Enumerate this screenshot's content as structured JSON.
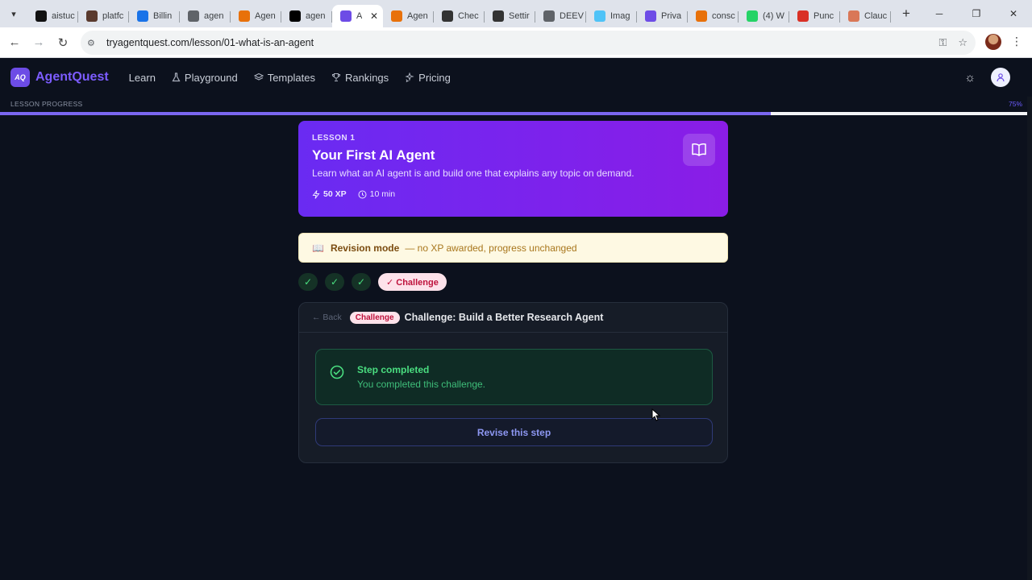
{
  "browser": {
    "tabs": [
      {
        "title": "aistuc",
        "favicon_color": "#111111",
        "active": false
      },
      {
        "title": "platfc",
        "favicon_color": "#5a3a2e",
        "active": false
      },
      {
        "title": "Billin",
        "favicon_color": "#1a73e8",
        "active": false
      },
      {
        "title": "agen",
        "favicon_color": "#5f6368",
        "active": false
      },
      {
        "title": "Agen",
        "favicon_color": "#e8710a",
        "active": false
      },
      {
        "title": "agen",
        "favicon_color": "#000000",
        "active": false
      },
      {
        "title": "A",
        "favicon_color": "#6d4ce6",
        "active": true
      },
      {
        "title": "Agen",
        "favicon_color": "#e8710a",
        "active": false
      },
      {
        "title": "Chec",
        "favicon_color": "#333333",
        "active": false
      },
      {
        "title": "Settir",
        "favicon_color": "#333333",
        "active": false
      },
      {
        "title": "DEEV",
        "favicon_color": "#5f6368",
        "active": false
      },
      {
        "title": "Imag",
        "favicon_color": "#4fc3f7",
        "active": false
      },
      {
        "title": "Priva",
        "favicon_color": "#6d4ce6",
        "active": false
      },
      {
        "title": "consc",
        "favicon_color": "#e8710a",
        "active": false
      },
      {
        "title": "(4) W",
        "favicon_color": "#25d366",
        "active": false
      },
      {
        "title": "Punc",
        "favicon_color": "#d93025",
        "active": false
      },
      {
        "title": "Clauc",
        "favicon_color": "#d97757",
        "active": false
      }
    ],
    "url": "tryagentquest.com/lesson/01-what-is-an-agent"
  },
  "header": {
    "logo_text": "AQ",
    "brand": "AgentQuest",
    "nav": [
      {
        "label": "Learn",
        "icon": ""
      },
      {
        "label": "Playground",
        "icon": "flask-icon"
      },
      {
        "label": "Templates",
        "icon": "layers-icon"
      },
      {
        "label": "Rankings",
        "icon": "trophy-icon"
      },
      {
        "label": "Pricing",
        "icon": "sparkles-icon"
      }
    ]
  },
  "progress": {
    "label": "LESSON PROGRESS",
    "value_text": "75%",
    "fraction": 0.75
  },
  "lesson": {
    "number": "LESSON 1",
    "title": "Your First AI Agent",
    "description": "Learn what an AI agent is and build one that explains any topic on demand.",
    "xp": "50 XP",
    "duration": "10 min"
  },
  "revision": {
    "icon": "book-emoji-icon",
    "title": "Revision mode",
    "note": "— no XP awarded, progress unchanged"
  },
  "steps": {
    "completed_marks": [
      "✓",
      "✓",
      "✓"
    ],
    "active_label": "✓ Challenge"
  },
  "challenge": {
    "back": "← Back",
    "badge": "Challenge",
    "title": "Challenge: Build a Better Research Agent",
    "status_title": "Step completed",
    "status_text": "You completed this challenge.",
    "revise_button": "Revise this step"
  },
  "colors": {
    "accent": "#7c5cff",
    "success": "#4ade80",
    "challenge_badge": "#be123c"
  }
}
